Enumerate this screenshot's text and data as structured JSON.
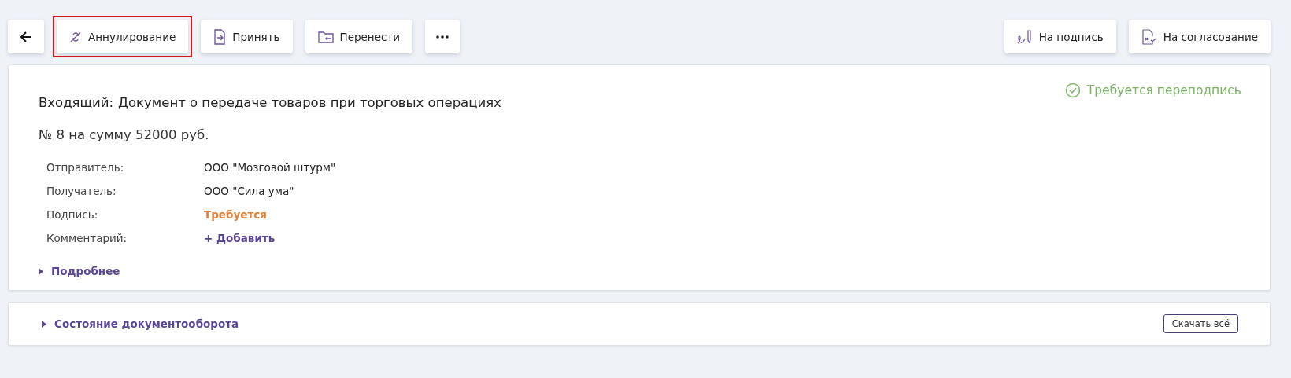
{
  "toolbar": {
    "left": [
      {
        "kind": "back",
        "highlighted": false
      },
      {
        "kind": "annul",
        "label": "Аннулирование",
        "highlighted": true
      },
      {
        "kind": "accept",
        "label": "Принять",
        "highlighted": false
      },
      {
        "kind": "move",
        "label": "Перенести",
        "highlighted": false
      },
      {
        "kind": "more",
        "highlighted": false
      }
    ],
    "right": [
      {
        "kind": "sign",
        "label": "На подпись"
      },
      {
        "kind": "approve",
        "label": "На согласование"
      }
    ]
  },
  "document": {
    "direction": "Входящий:",
    "title": "Документ о передаче товаров при торговых операциях",
    "status": "Требуется переподпись",
    "number": "№ 8 на сумму 52000 руб.",
    "fields": [
      {
        "kind": "text",
        "label": "Отправитель:",
        "value": "ООО \"Мозговой штурм\""
      },
      {
        "kind": "text",
        "label": "Получатель:",
        "value": "ООО \"Сила ума\""
      },
      {
        "kind": "warning",
        "label": "Подпись:",
        "value": "Требуется"
      },
      {
        "kind": "link",
        "label": "Комментарий:",
        "value": "+ Добавить"
      }
    ],
    "details": {
      "label": "Подробнее",
      "expanded": false
    }
  },
  "workflow": {
    "label": "Состояние документооборота",
    "expanded": false,
    "download": "Скачать всё"
  }
}
